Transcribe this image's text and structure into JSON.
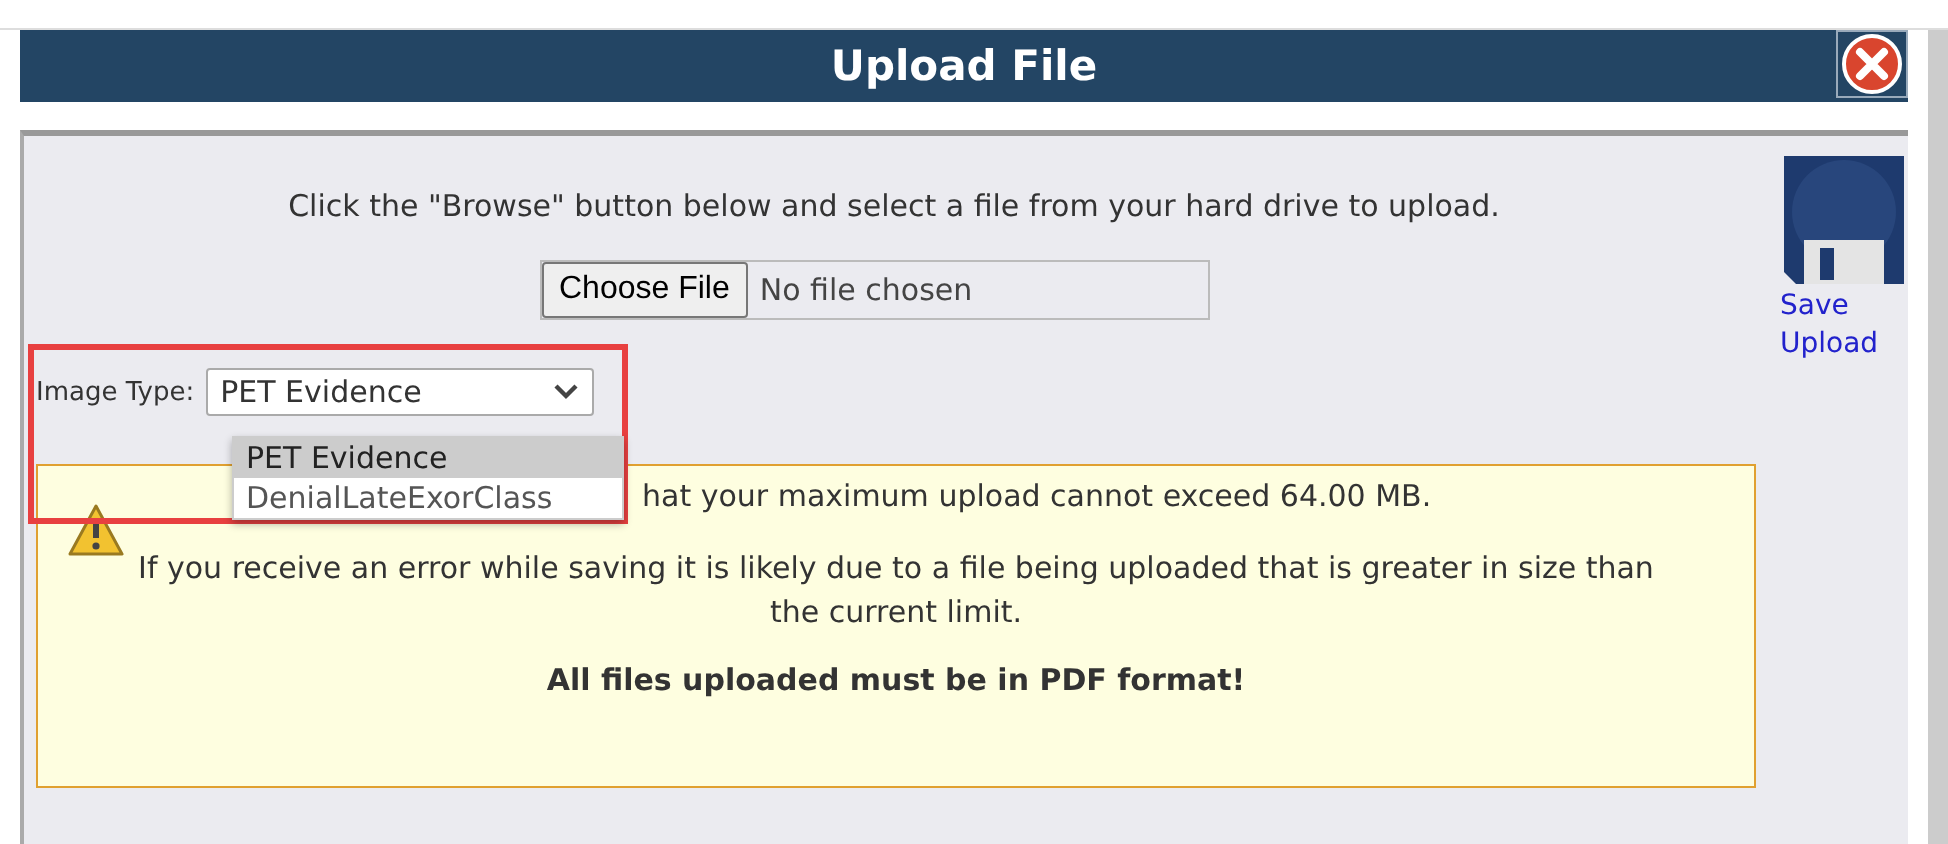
{
  "dialog": {
    "title": "Upload File"
  },
  "instructions": "Click the \"Browse\" button below and select a file from your hard drive to upload.",
  "file_input": {
    "button": "Choose File",
    "value": "No file chosen"
  },
  "image_type": {
    "label": "Image Type:",
    "value": "PET Evidence",
    "expanded": true,
    "options": [
      {
        "label": "PET Evidence",
        "selected": true
      },
      {
        "label": "DenialLateExorClass",
        "selected": false
      }
    ]
  },
  "notice": {
    "lines": [
      "hat your maximum upload cannot exceed 64.00 MB.",
      "If you receive an error while saving it is likely due to a file being uploaded that is greater in size than the current limit."
    ],
    "emphasis": "All files uploaded must be in PDF format!"
  },
  "save_action": {
    "label": "Save Upload"
  }
}
